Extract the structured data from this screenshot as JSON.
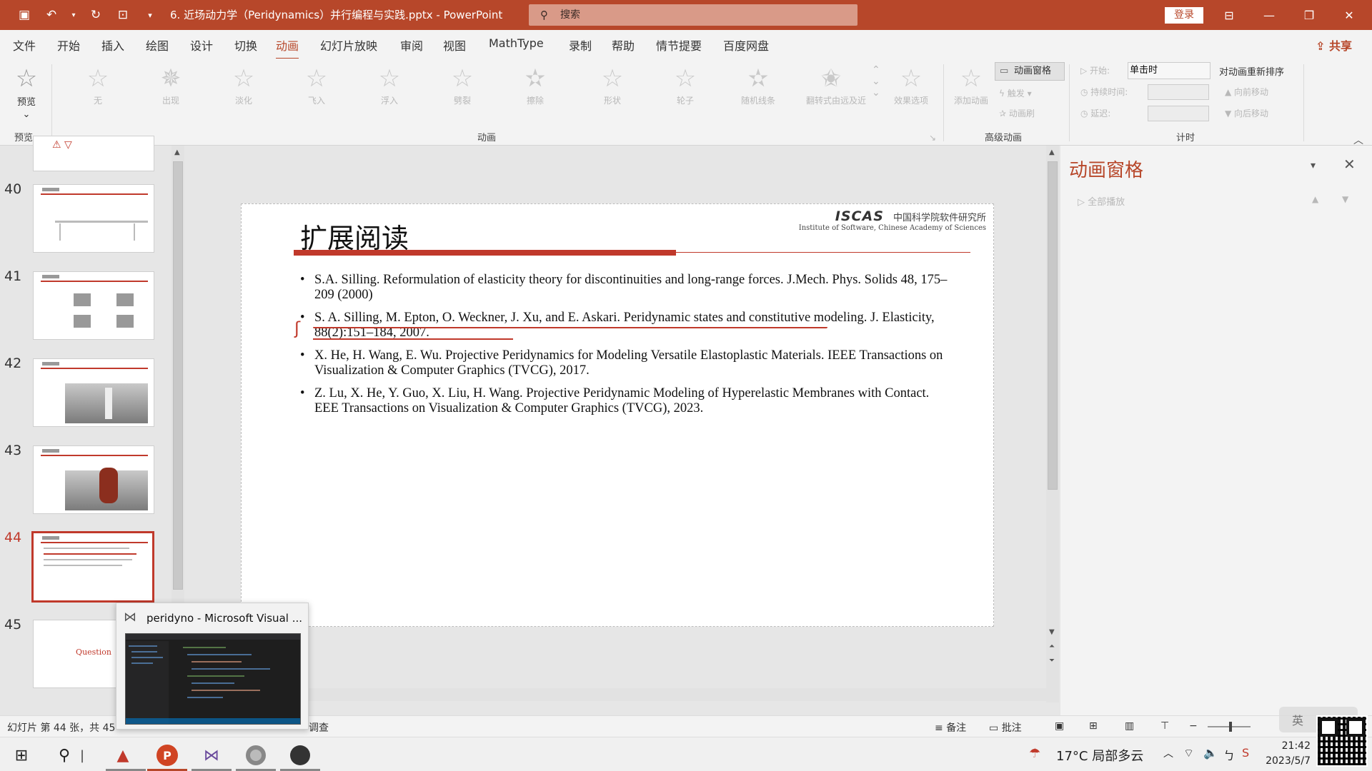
{
  "titlebar": {
    "document_title": "6. 近场动力学（Peridynamics）并行编程与实践.pptx  -  PowerPoint",
    "search_placeholder": "搜索",
    "login": "登录",
    "bg_color": "#b7472a"
  },
  "menu": {
    "tabs": [
      "文件",
      "开始",
      "插入",
      "绘图",
      "设计",
      "切换",
      "动画",
      "幻灯片放映",
      "审阅",
      "视图",
      "MathType",
      "录制",
      "帮助",
      "情节提要",
      "百度网盘"
    ],
    "active_tab": "动画",
    "share": "共享"
  },
  "ribbon": {
    "preview_label": "预览",
    "preview_group": "预览",
    "animation_items": [
      "无",
      "出现",
      "淡化",
      "飞入",
      "浮入",
      "劈裂",
      "擦除",
      "形状",
      "轮子",
      "随机线条",
      "翻转式由远及近"
    ],
    "effect_options": "效果选项",
    "animation_group": "动画",
    "add_animation": "添加动画",
    "animation_pane_btn": "动画窗格",
    "trigger": "触发",
    "animation_painter": "动画刷",
    "advanced_group": "高级动画",
    "start_label": "开始:",
    "start_value": "单击时",
    "duration_label": "持续时间:",
    "delay_label": "延迟:",
    "reorder_title": "对动画重新排序",
    "move_earlier": "向前移动",
    "move_later": "向后移动",
    "timing_group": "计时"
  },
  "slides_panel": {
    "numbers": [
      "40",
      "41",
      "42",
      "43",
      "44",
      "45"
    ],
    "active": "44",
    "last_thumb_text": "Question"
  },
  "slide": {
    "title": "扩展阅读",
    "logo_mark": "ISCAS",
    "logo_cn": "中国科学院软件研究所",
    "logo_en": "Institute of Software, Chinese Academy of Sciences",
    "references": [
      "S.A. Silling. Reformulation of elasticity theory for discontinuities and long-range forces. J.Mech. Phys. Solids 48, 175–209 (2000)",
      "S. A. Silling, M. Epton, O. Weckner, J. Xu, and E. Askari. Peridynamic states and constitutive modeling. J. Elasticity, 88(2):151–184, 2007.",
      "X. He, H. Wang, E. Wu. Projective Peridynamics for Modeling Versatile Elastoplastic Materials. IEEE Transactions on Visualization & Computer Graphics (TVCG), 2017.",
      "Z. Lu, X. He, Y. Guo, X. Liu, H. Wang. Projective Peridynamic Modeling of Hyperelastic Membranes with Contact. EEE Transactions on Visualization & Computer Graphics (TVCG), 2023."
    ]
  },
  "animation_pane": {
    "title": "动画窗格",
    "play_all": "全部播放"
  },
  "statusbar": {
    "slide_info": "幻灯片 第 44 张，共 45",
    "accessibility": "调查",
    "notes": "备注",
    "comments": "批注"
  },
  "popup": {
    "title": "peridyno - Microsoft Visual ..."
  },
  "taskbar": {
    "weather": "17°C  局部多云",
    "ime": "英",
    "time": "21:42",
    "date": "2023/5/7"
  }
}
